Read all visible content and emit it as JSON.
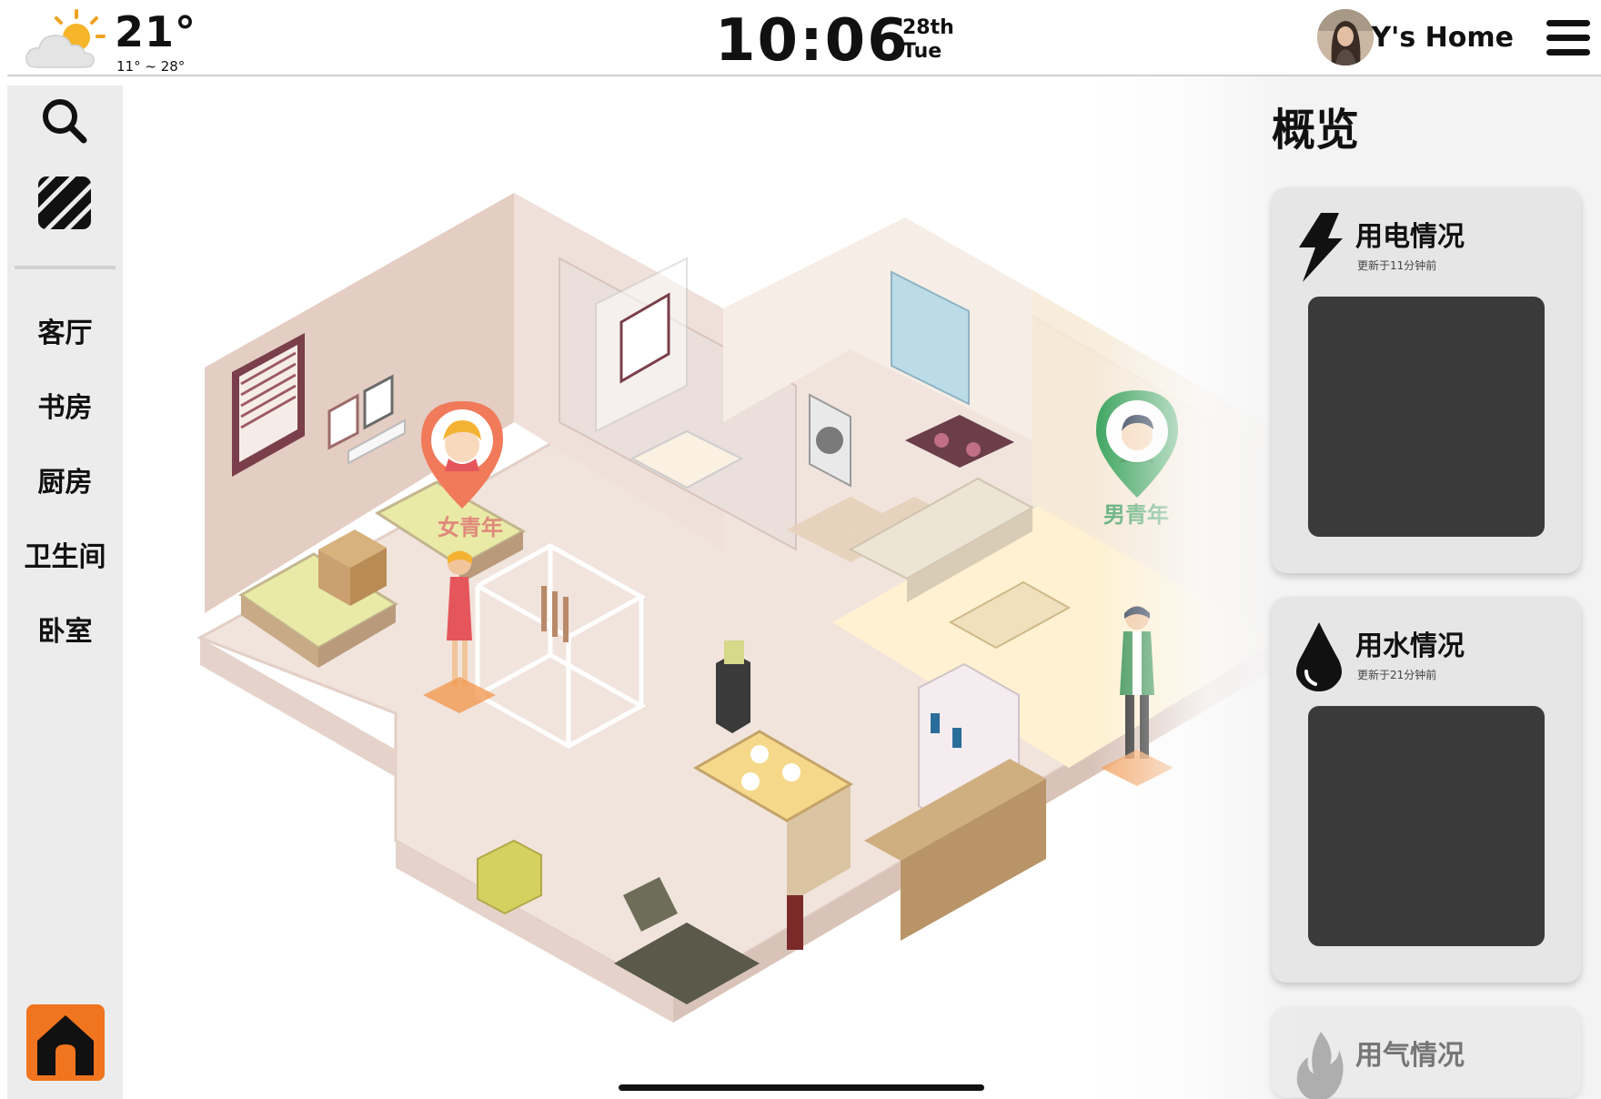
{
  "weather": {
    "icon": "partly-cloudy-icon",
    "temperature": "21°",
    "range": "11° ~ 28°"
  },
  "clock": {
    "time": "10:06",
    "date": "28th\nTue"
  },
  "profile": {
    "home_name": "Y's Home",
    "avatar": "avatar"
  },
  "sidebar": {
    "rooms": [
      "客厅",
      "书房",
      "厨房",
      "卫生间",
      "卧室"
    ],
    "home_button_color": "#f0751e"
  },
  "floorplan": {
    "occupants": [
      {
        "label": "女青年",
        "pin_color": "#f07a5a"
      },
      {
        "label": "男青年",
        "pin_color": "#3aa35c"
      }
    ]
  },
  "overview": {
    "title": "概览",
    "cards": [
      {
        "icon": "lightning-icon",
        "title": "用电情况",
        "updated": "更新于11分钟前"
      },
      {
        "icon": "water-drop-icon",
        "title": "用水情况",
        "updated": "更新于21分钟前"
      },
      {
        "icon": "flame-icon",
        "title": "用气情况"
      }
    ]
  }
}
